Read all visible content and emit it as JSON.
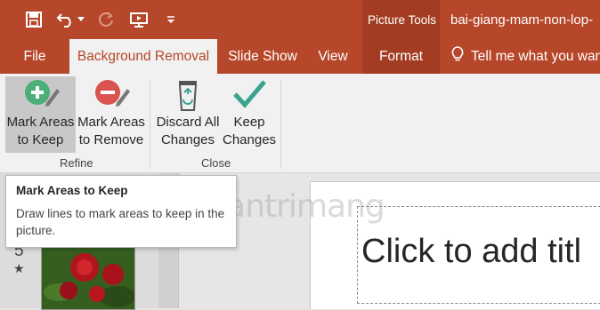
{
  "colors": {
    "accent": "#b7472a",
    "context": "#a33c22",
    "ribbon": "#f1f1f1",
    "plus_green": "#4caf7a",
    "minus_red": "#d9534f",
    "check_teal": "#3aa38f"
  },
  "quick_access": {
    "save_icon": "save-icon",
    "undo_icon": "undo-icon",
    "redo_icon": "redo-icon",
    "present_icon": "present-icon",
    "customize_icon": "customize-icon"
  },
  "context_tab_header": "Picture Tools",
  "document_title": "bai-giang-mam-non-lop-",
  "tabs": {
    "file": "File",
    "background_removal": "Background Removal",
    "slide_show": "Slide Show",
    "view": "View",
    "format": "Format",
    "tell_me": "Tell me what you want"
  },
  "ribbon": {
    "mark_keep": {
      "line1": "Mark Areas",
      "line2": "to Keep"
    },
    "mark_remove": {
      "line1": "Mark Areas",
      "line2": "to Remove"
    },
    "discard": {
      "line1": "Discard All",
      "line2": "Changes"
    },
    "keep_changes": {
      "line1": "Keep",
      "line2": "Changes"
    },
    "group_refine": "Refine",
    "group_close": "Close"
  },
  "tooltip": {
    "title": "Mark Areas to Keep",
    "description": "Draw lines to mark areas to keep in the picture."
  },
  "watermark": "Quantrimang",
  "slide_panel": {
    "number": "5",
    "star": "★"
  },
  "slide": {
    "title_placeholder": "Click to add titl"
  }
}
